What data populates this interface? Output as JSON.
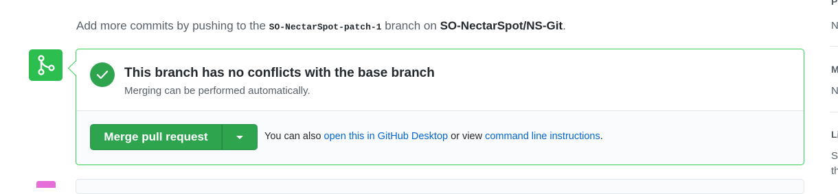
{
  "push_note": {
    "prefix": "Add more commits by pushing to the",
    "branch": "SO-NectarSpot-patch-1",
    "middle": "branch on",
    "repo": "SO-NectarSpot/NS-Git",
    "suffix": "."
  },
  "merge_status": {
    "title": "This branch has no conflicts with the base branch",
    "subtitle": "Merging can be performed automatically."
  },
  "merge_actions": {
    "merge_button_label": "Merge pull request",
    "also_prefix": "You can also",
    "desktop_link": "open this in GitHub Desktop",
    "or_view": "or view",
    "cli_link": "command line instructions",
    "suffix": "."
  },
  "sidebar_fragments": {
    "lines": [
      "P",
      "N",
      "M",
      "N",
      "Li",
      "S",
      "th"
    ]
  },
  "colors": {
    "success_green": "#2ea44f",
    "border_green": "#34d058",
    "link_blue": "#0366d6",
    "muted_text": "#586069"
  },
  "icons": {
    "merge_badge": "git-merge-icon",
    "status": "check-icon",
    "dropdown": "caret-down-icon"
  }
}
